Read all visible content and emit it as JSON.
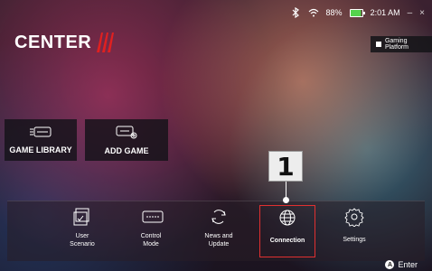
{
  "status": {
    "battery": "88%",
    "time": "2:01 AM",
    "minimize": "–",
    "close": "×",
    "icons": [
      "bluetooth-icon",
      "wifi-icon",
      "battery-icon"
    ]
  },
  "brand": {
    "name": "CENTER"
  },
  "platform": {
    "label": "Gaming Platform"
  },
  "tiles": [
    {
      "label": "GAME LIBRARY",
      "icon": "keyboard-icon"
    },
    {
      "label": "ADD GAME",
      "icon": "gamepad-add-icon"
    }
  ],
  "menu": [
    {
      "label": "User\nScenario",
      "icon": "scenario-icon"
    },
    {
      "label": "Control\nMode",
      "icon": "control-mode-icon"
    },
    {
      "label": "News and\nUpdate",
      "icon": "refresh-icon"
    },
    {
      "label": "Connection",
      "icon": "globe-icon"
    },
    {
      "label": "Settings",
      "icon": "gear-icon"
    }
  ],
  "callout": {
    "number": "1"
  },
  "footer": {
    "button": "A",
    "label": "Enter"
  },
  "colors": {
    "selection": "#e03030",
    "battery_fill": "#55d24c",
    "logo_accent": "#e02020"
  }
}
